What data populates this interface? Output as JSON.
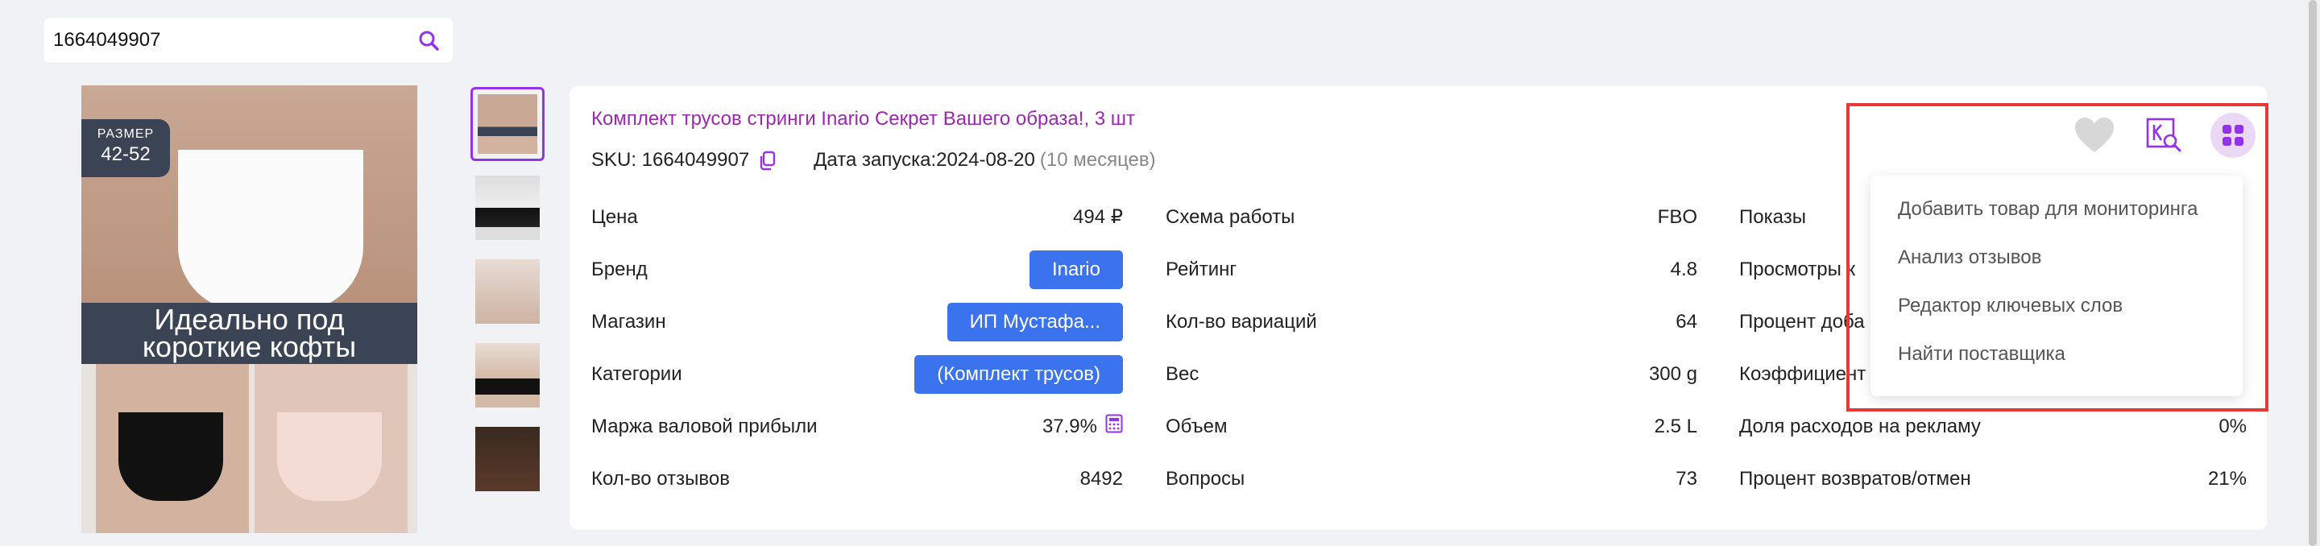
{
  "search": {
    "value": "1664049907"
  },
  "product_image": {
    "size_label": "РАЗМЕР",
    "size_range": "42-52",
    "banner": "Идеально под короткие кофты"
  },
  "product": {
    "title": "Комплект трусов стринги Inario Секрет Вашего образа!, 3 шт",
    "sku_label": "SKU: 1664049907",
    "launch_label": "Дата запуска:2024-08-20",
    "launch_age": "(10 месяцев)"
  },
  "col1": [
    {
      "label": "Цена",
      "value": "494 ₽"
    },
    {
      "label": "Бренд",
      "value": "Inario"
    },
    {
      "label": "Магазин",
      "value": "ИП Мустафа..."
    },
    {
      "label": "Категории",
      "value": "(Комплект трусов)"
    },
    {
      "label": "Маржа валовой прибыли",
      "value": "37.9%"
    },
    {
      "label": "Кол-во отзывов",
      "value": "8492"
    }
  ],
  "col2": [
    {
      "label": "Схема работы",
      "value": "FBO"
    },
    {
      "label": "Рейтинг",
      "value": "4.8"
    },
    {
      "label": "Кол-во вариаций",
      "value": "64"
    },
    {
      "label": "Вес",
      "value": "300 g"
    },
    {
      "label": "Объем",
      "value": "2.5 L"
    },
    {
      "label": "Вопросы",
      "value": "73"
    }
  ],
  "col3": [
    {
      "label": "Показы",
      "value": ""
    },
    {
      "label": "Просмотры к",
      "value": ""
    },
    {
      "label": "Процент доба",
      "value": ""
    },
    {
      "label": "Коэффициент",
      "value": ""
    },
    {
      "label": "Доля расходов на рекламу",
      "value": "0%"
    },
    {
      "label": "Процент возвратов/отмен",
      "value": "21%"
    }
  ],
  "menu": {
    "items": [
      "Добавить товар для мониторинга",
      "Анализ отзывов",
      "Редактор ключевых слов",
      "Найти поставщика"
    ]
  },
  "colors": {
    "accent": "#9333ea",
    "title": "#9c27b0",
    "button": "#3b73ee",
    "highlight": "#e53935"
  }
}
